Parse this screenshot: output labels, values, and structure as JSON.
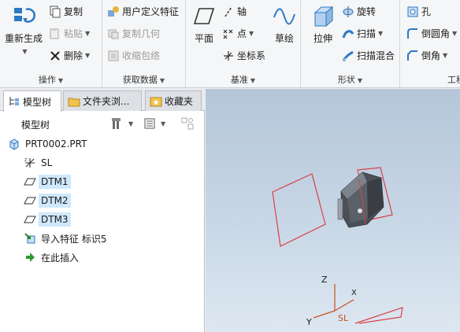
{
  "ribbon": {
    "operations": {
      "regenerate_label": "重新生成",
      "copy_label": "复制",
      "paste_label": "粘贴",
      "delete_label": "删除",
      "group_label": "操作"
    },
    "get_data": {
      "udf_label": "用户定义特征",
      "copy_geom_label": "复制几何",
      "shrinkwrap_label": "收缩包络",
      "group_label": "获取数据"
    },
    "datum": {
      "plane_label": "平面",
      "axis_label": "轴",
      "point_label": "点",
      "csys_label": "坐标系",
      "sketch_label": "草绘",
      "group_label": "基准"
    },
    "shapes": {
      "extrude_label": "拉伸",
      "revolve_label": "旋转",
      "sweep_label": "扫描",
      "swept_blend_label": "扫描混合",
      "group_label": "形状"
    },
    "engineering": {
      "hole_label": "孔",
      "round_label": "倒圆角",
      "chamfer_label": "倒角",
      "group_label": "工程"
    }
  },
  "tabs": [
    {
      "label": "模型树"
    },
    {
      "label": "文件夹浏..."
    },
    {
      "label": "收藏夹"
    }
  ],
  "tree": {
    "title": "模型树",
    "root": "PRT0002.PRT",
    "items": [
      {
        "label": "SL",
        "icon": "csys-icon",
        "selected": false
      },
      {
        "label": "DTM1",
        "icon": "datum-plane-icon",
        "selected": true
      },
      {
        "label": "DTM2",
        "icon": "datum-plane-icon",
        "selected": true
      },
      {
        "label": "DTM3",
        "icon": "datum-plane-icon",
        "selected": true
      },
      {
        "label": "导入特征 标识5",
        "icon": "import-feature-icon",
        "selected": false
      },
      {
        "label": "在此插入",
        "icon": "insert-here-icon",
        "selected": false
      }
    ]
  },
  "viewport": {
    "axis_z": "Z",
    "axis_x": "X",
    "axis_y": "Y",
    "csys_label": "SL"
  },
  "colors": {
    "accent_blue": "#1f6fbf",
    "selection": "#cfe8fb",
    "datum_red": "#d94048",
    "csys_orange": "#c8501e"
  }
}
